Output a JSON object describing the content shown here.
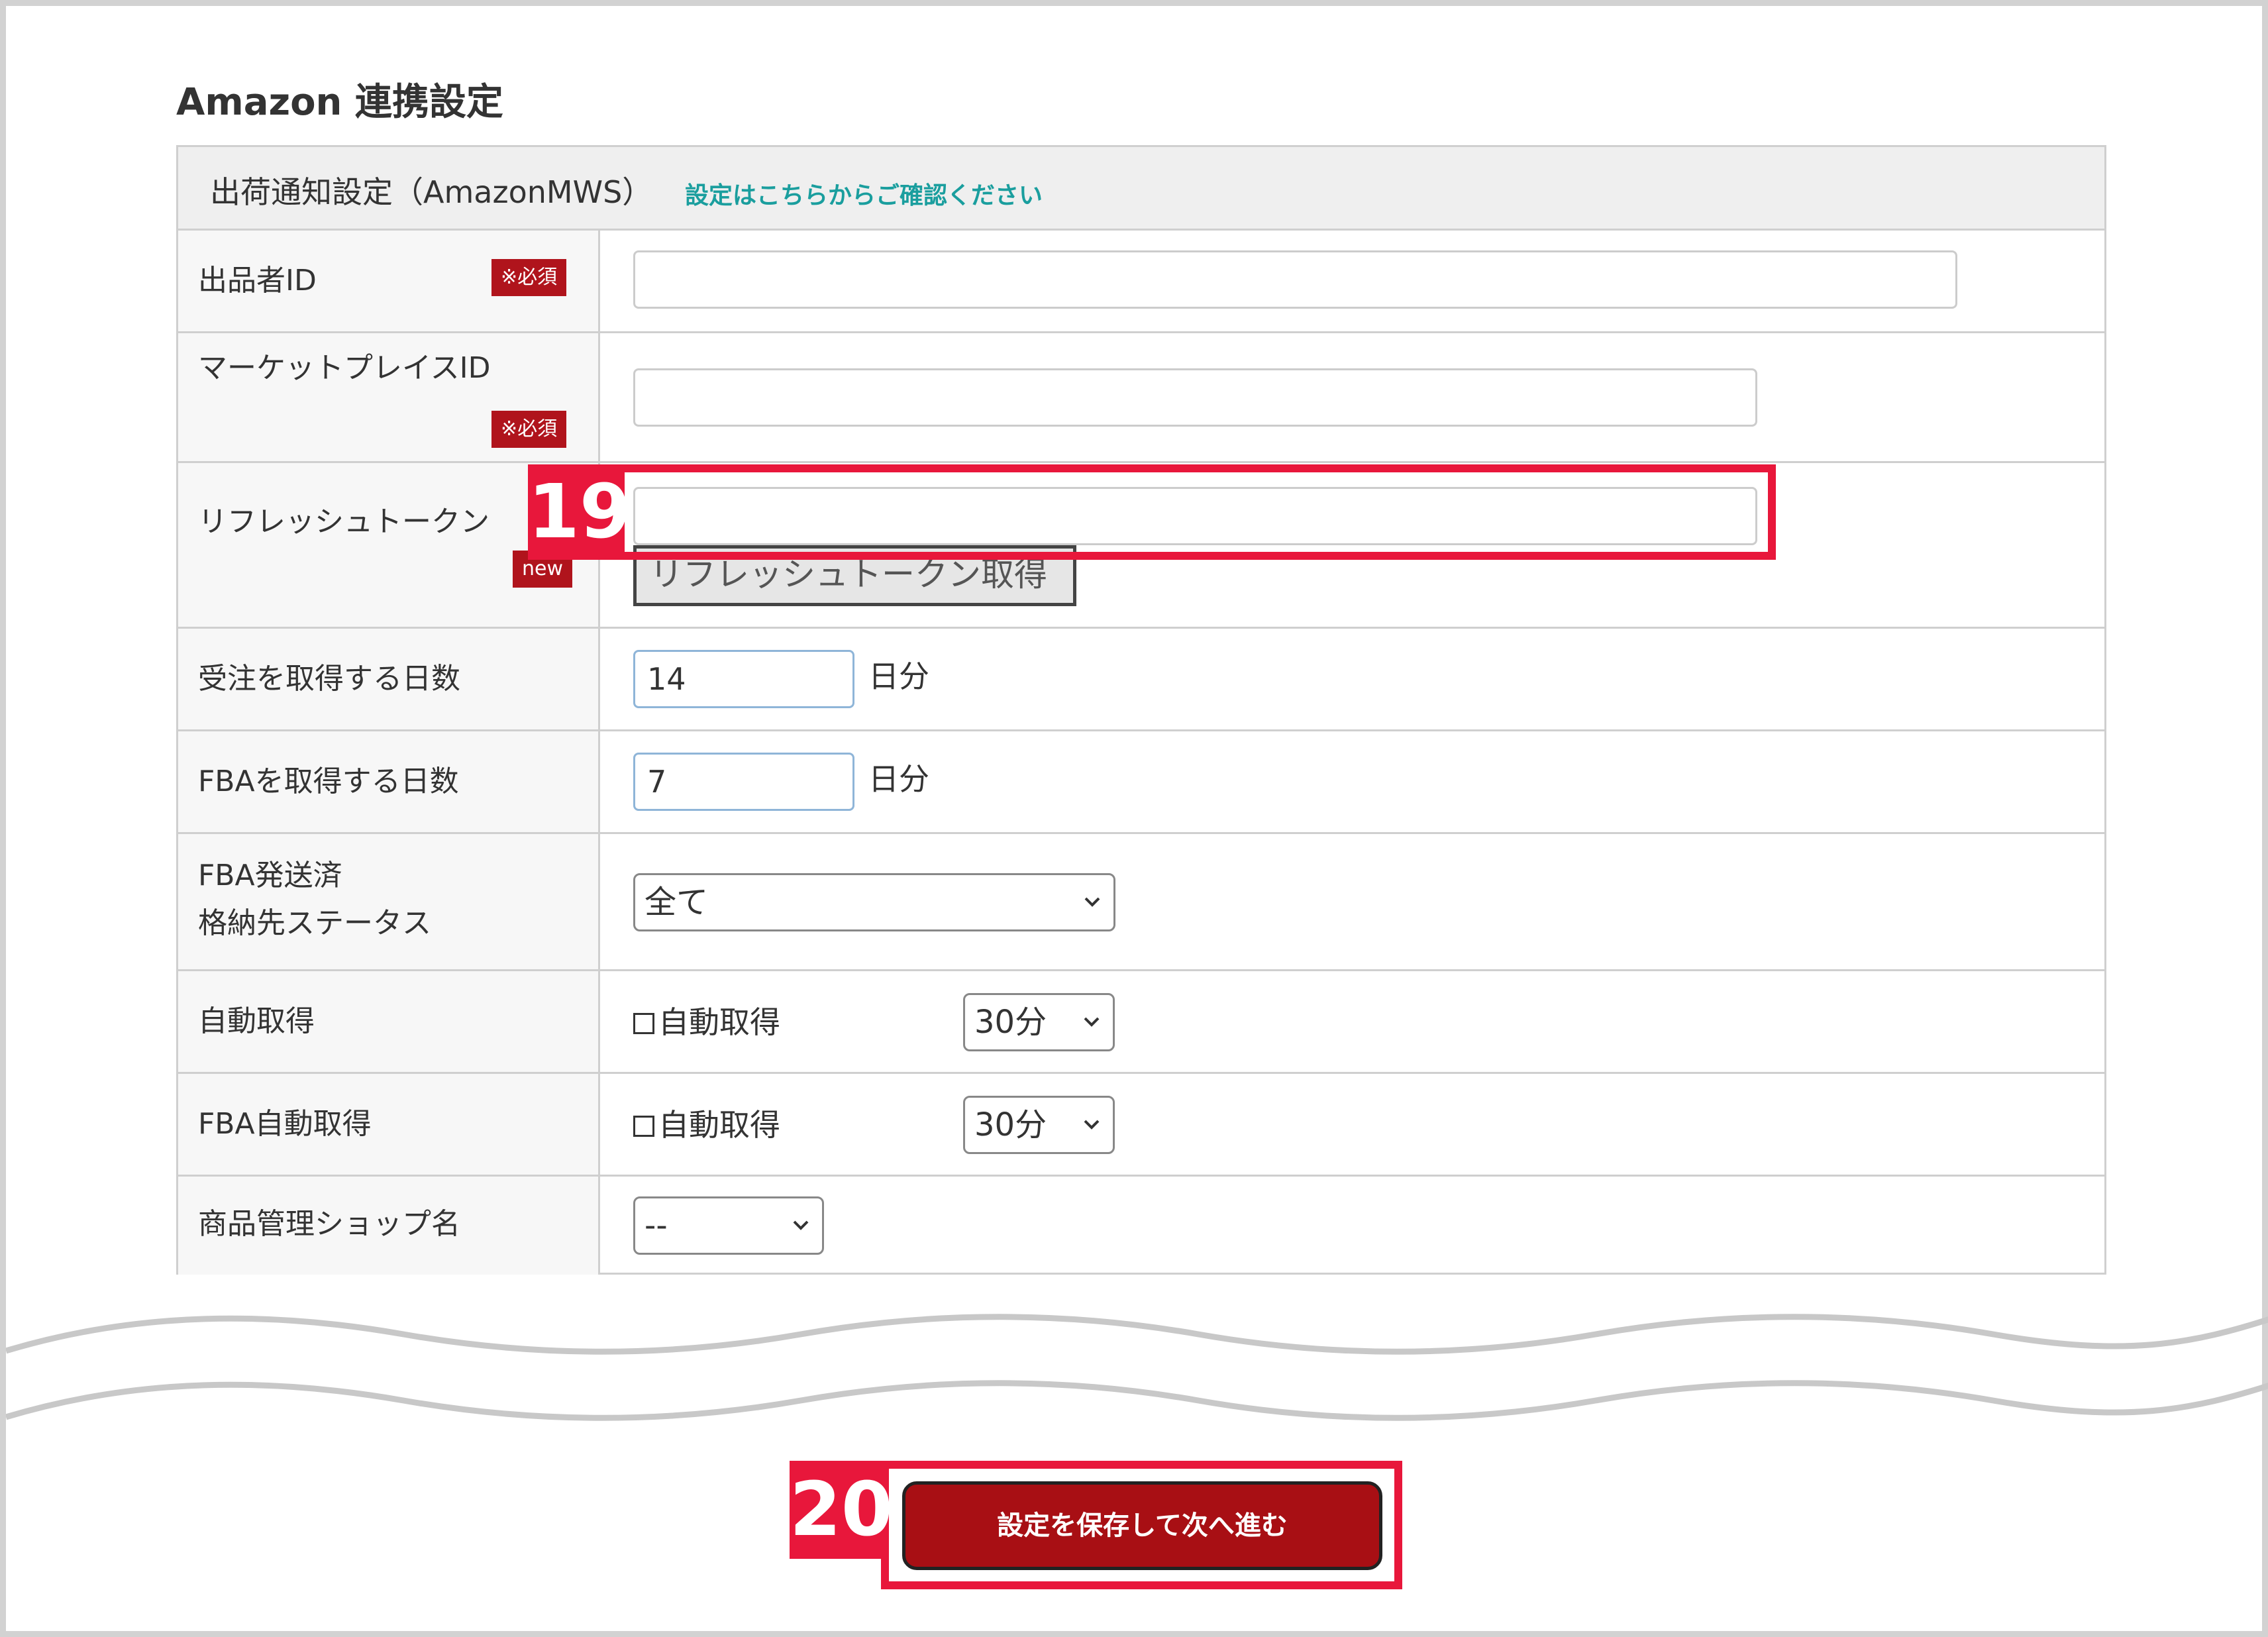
{
  "page_title": "Amazon 連携設定",
  "section": {
    "header": "出荷通知設定（AmazonMWS）",
    "header_link": "設定はこちらからご確認ください"
  },
  "badges": {
    "required": "※必須",
    "new": "new"
  },
  "fields": {
    "seller_id": {
      "label": "出品者ID",
      "value": ""
    },
    "marketplace_id": {
      "label": "マーケットプレイスID",
      "value": ""
    },
    "refresh_token": {
      "label": "リフレッシュトークン",
      "value": "",
      "button": "リフレッシュトークン取得"
    },
    "order_days": {
      "label": "受注を取得する日数",
      "value": "14",
      "unit": "日分"
    },
    "fba_days": {
      "label": "FBAを取得する日数",
      "value": "7",
      "unit": "日分"
    },
    "fba_status": {
      "label_line1": "FBA発送済",
      "label_line2": "格納先ステータス",
      "selected": "全て"
    },
    "auto_fetch": {
      "label": "自動取得",
      "checkbox_label": "自動取得",
      "checked": false,
      "interval": "30分"
    },
    "fba_auto_fetch": {
      "label": "FBA自動取得",
      "checkbox_label": "自動取得",
      "checked": false,
      "interval": "30分"
    },
    "shop_name": {
      "label": "商品管理ショップ名",
      "selected": "--"
    }
  },
  "save_button": "設定を保存して次へ進む",
  "callouts": {
    "first": "19",
    "second": "20"
  },
  "colors": {
    "required_badge": "#b0141c",
    "link": "#1a9e9e",
    "callout": "#e8173b",
    "save_button": "#a80f14"
  }
}
